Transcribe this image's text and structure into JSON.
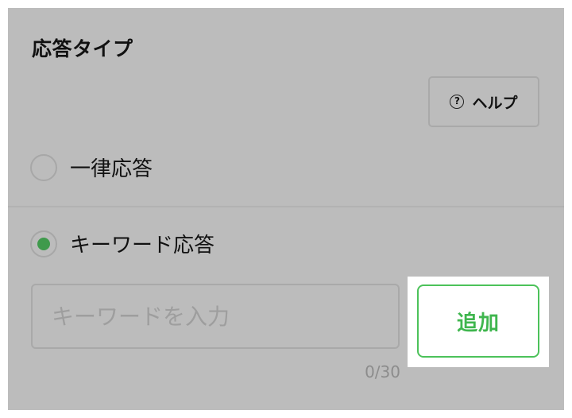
{
  "section": {
    "title": "応答タイプ"
  },
  "help_button": {
    "icon": "question-circle-icon",
    "label": "ヘルプ"
  },
  "response_types": [
    {
      "label": "一律応答",
      "selected": false
    },
    {
      "label": "キーワード応答",
      "selected": true
    }
  ],
  "keyword_input": {
    "placeholder": "キーワードを入力",
    "value": ""
  },
  "char_count": "0/30",
  "add_button": {
    "label": "追加"
  },
  "colors": {
    "overlay": "#bcbcbc",
    "accent_green": "#3fb64e",
    "radio_dot": "#3f9a4c"
  }
}
